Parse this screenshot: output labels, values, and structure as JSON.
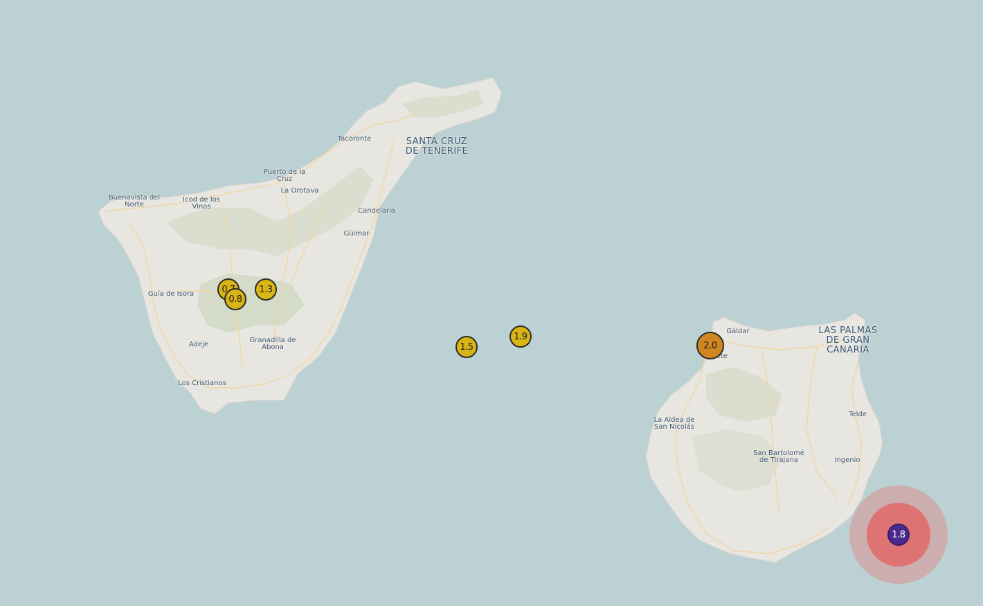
{
  "map": {
    "colors": {
      "water": "#bcd1d3",
      "land": "#e8e6e0",
      "roads": "#f3d49a",
      "vegetation": "#d7dccb",
      "label": "#3e5670"
    },
    "place_labels": [
      {
        "id": "santa-cruz",
        "text": "SANTA CRUZ\nDE TENERIFE",
        "major": true
      },
      {
        "id": "las-palmas",
        "text": "LAS PALMAS\nDE GRAN\nCANARIA",
        "major": true
      },
      {
        "id": "tacoronte",
        "text": "Tacoronte"
      },
      {
        "id": "puerto-de-la-cruz",
        "text": "Puerto de la\nCruz"
      },
      {
        "id": "la-orotava",
        "text": "La Orotava"
      },
      {
        "id": "buenavista",
        "text": "Buenavista del\nNorte"
      },
      {
        "id": "icod",
        "text": "Icod de los\nVinos"
      },
      {
        "id": "candelaria",
        "text": "Candelaria"
      },
      {
        "id": "guimar",
        "text": "Güimar"
      },
      {
        "id": "guia-de-isora",
        "text": "Guía de Isora"
      },
      {
        "id": "adeje",
        "text": "Adeje"
      },
      {
        "id": "granadilla",
        "text": "Granadilla de\nAbona"
      },
      {
        "id": "los-cristianos",
        "text": "Los Cristianos"
      },
      {
        "id": "galdar",
        "text": "Gáldar"
      },
      {
        "id": "agaete",
        "text": "Agaete"
      },
      {
        "id": "la-aldea",
        "text": "La Aldea de\nSan Nicolás"
      },
      {
        "id": "telde",
        "text": "Telde"
      },
      {
        "id": "san-bartolome",
        "text": "San Bartolomé\nde Tirajana"
      },
      {
        "id": "ingenio",
        "text": "Ingenio"
      }
    ],
    "quakes": [
      {
        "id": "quake-0-7",
        "magnitude": "0.7",
        "color": "#d8b414"
      },
      {
        "id": "quake-0-8",
        "magnitude": "0.8",
        "color": "#d8b414"
      },
      {
        "id": "quake-1-3",
        "magnitude": "1.3",
        "color": "#d8b414"
      },
      {
        "id": "quake-1-5",
        "magnitude": "1.5",
        "color": "#d8b414"
      },
      {
        "id": "quake-1-9",
        "magnitude": "1.9",
        "color": "#d8b414"
      },
      {
        "id": "quake-2-0",
        "magnitude": "2.0",
        "color": "#d08620"
      },
      {
        "id": "quake-1-8",
        "magnitude": "1.8",
        "color": "#4a2a8c",
        "text_color": "#ffffff",
        "highlighted": true
      }
    ]
  }
}
